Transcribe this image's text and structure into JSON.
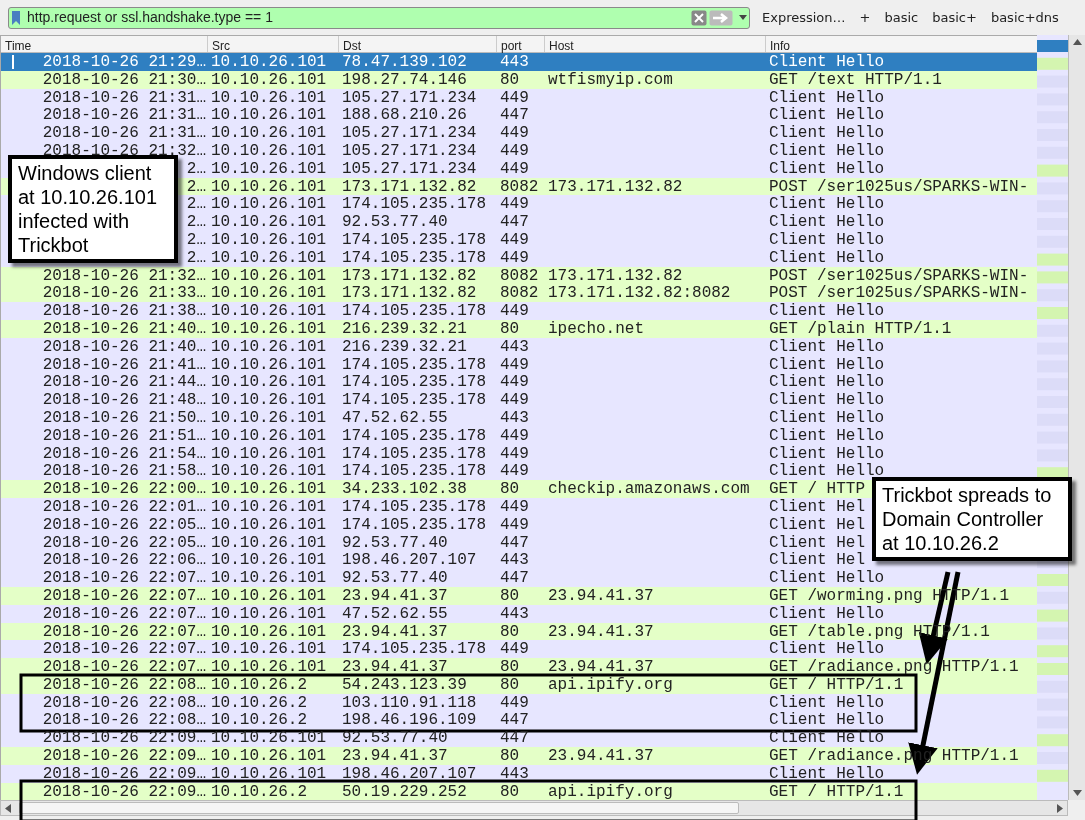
{
  "filter": {
    "value": "http.request or ssl.handshake.type == 1"
  },
  "toolbar_buttons": [
    "Expression…",
    "+",
    "basic",
    "basic+",
    "basic+dns"
  ],
  "table": {
    "columns": [
      "Time",
      "Src",
      "Dst",
      "port",
      "Host",
      "Info"
    ],
    "rows": [
      {
        "kind": "tls",
        "selected": true,
        "cells": [
          "2018-10-26 21:29…",
          "10.10.26.101",
          "78.47.139.102",
          "443",
          "",
          "Client Hello"
        ]
      },
      {
        "kind": "http",
        "selected": false,
        "cells": [
          "2018-10-26 21:30…",
          "10.10.26.101",
          "198.27.74.146",
          "80",
          "wtfismyip.com",
          "GET /text HTTP/1.1"
        ]
      },
      {
        "kind": "tls",
        "selected": false,
        "cells": [
          "2018-10-26 21:31…",
          "10.10.26.101",
          "105.27.171.234",
          "449",
          "",
          "Client Hello"
        ]
      },
      {
        "kind": "tls",
        "selected": false,
        "cells": [
          "2018-10-26 21:31…",
          "10.10.26.101",
          "188.68.210.26",
          "447",
          "",
          "Client Hello"
        ]
      },
      {
        "kind": "tls",
        "selected": false,
        "cells": [
          "2018-10-26 21:31…",
          "10.10.26.101",
          "105.27.171.234",
          "449",
          "",
          "Client Hello"
        ]
      },
      {
        "kind": "tls",
        "selected": false,
        "cells": [
          "2018-10-26 21:32…",
          "10.10.26.101",
          "105.27.171.234",
          "449",
          "",
          "Client Hello"
        ]
      },
      {
        "kind": "tls",
        "selected": false,
        "cells": [
          "2…",
          "10.10.26.101",
          "105.27.171.234",
          "449",
          "",
          "Client Hello"
        ]
      },
      {
        "kind": "http",
        "selected": false,
        "cells": [
          "2…",
          "10.10.26.101",
          "173.171.132.82",
          "8082",
          "173.171.132.82",
          "POST /ser1025us/SPARKS-WIN-"
        ]
      },
      {
        "kind": "tls",
        "selected": false,
        "cells": [
          "2…",
          "10.10.26.101",
          "174.105.235.178",
          "449",
          "",
          "Client Hello"
        ]
      },
      {
        "kind": "tls",
        "selected": false,
        "cells": [
          "2…",
          "10.10.26.101",
          "92.53.77.40",
          "447",
          "",
          "Client Hello"
        ]
      },
      {
        "kind": "tls",
        "selected": false,
        "cells": [
          "2…",
          "10.10.26.101",
          "174.105.235.178",
          "449",
          "",
          "Client Hello"
        ]
      },
      {
        "kind": "tls",
        "selected": false,
        "cells": [
          "2…",
          "10.10.26.101",
          "174.105.235.178",
          "449",
          "",
          "Client Hello"
        ]
      },
      {
        "kind": "http",
        "selected": false,
        "cells": [
          "2018-10-26 21:32…",
          "10.10.26.101",
          "173.171.132.82",
          "8082",
          "173.171.132.82",
          "POST /ser1025us/SPARKS-WIN-"
        ]
      },
      {
        "kind": "http",
        "selected": false,
        "cells": [
          "2018-10-26 21:33…",
          "10.10.26.101",
          "173.171.132.82",
          "8082",
          "173.171.132.82:8082",
          "POST /ser1025us/SPARKS-WIN-"
        ]
      },
      {
        "kind": "tls",
        "selected": false,
        "cells": [
          "2018-10-26 21:38…",
          "10.10.26.101",
          "174.105.235.178",
          "449",
          "",
          "Client Hello"
        ]
      },
      {
        "kind": "http",
        "selected": false,
        "cells": [
          "2018-10-26 21:40…",
          "10.10.26.101",
          "216.239.32.21",
          "80",
          "ipecho.net",
          "GET /plain HTTP/1.1"
        ]
      },
      {
        "kind": "tls",
        "selected": false,
        "cells": [
          "2018-10-26 21:40…",
          "10.10.26.101",
          "216.239.32.21",
          "443",
          "",
          "Client Hello"
        ]
      },
      {
        "kind": "tls",
        "selected": false,
        "cells": [
          "2018-10-26 21:41…",
          "10.10.26.101",
          "174.105.235.178",
          "449",
          "",
          "Client Hello"
        ]
      },
      {
        "kind": "tls",
        "selected": false,
        "cells": [
          "2018-10-26 21:44…",
          "10.10.26.101",
          "174.105.235.178",
          "449",
          "",
          "Client Hello"
        ]
      },
      {
        "kind": "tls",
        "selected": false,
        "cells": [
          "2018-10-26 21:48…",
          "10.10.26.101",
          "174.105.235.178",
          "449",
          "",
          "Client Hello"
        ]
      },
      {
        "kind": "tls",
        "selected": false,
        "cells": [
          "2018-10-26 21:50…",
          "10.10.26.101",
          "47.52.62.55",
          "443",
          "",
          "Client Hello"
        ]
      },
      {
        "kind": "tls",
        "selected": false,
        "cells": [
          "2018-10-26 21:51…",
          "10.10.26.101",
          "174.105.235.178",
          "449",
          "",
          "Client Hello"
        ]
      },
      {
        "kind": "tls",
        "selected": false,
        "cells": [
          "2018-10-26 21:54…",
          "10.10.26.101",
          "174.105.235.178",
          "449",
          "",
          "Client Hello"
        ]
      },
      {
        "kind": "tls",
        "selected": false,
        "cells": [
          "2018-10-26 21:58…",
          "10.10.26.101",
          "174.105.235.178",
          "449",
          "",
          "Client Hello"
        ]
      },
      {
        "kind": "http",
        "selected": false,
        "cells": [
          "2018-10-26 22:00…",
          "10.10.26.101",
          "34.233.102.38",
          "80",
          "checkip.amazonaws.com",
          "GET / HTTP"
        ]
      },
      {
        "kind": "tls",
        "selected": false,
        "cells": [
          "2018-10-26 22:01…",
          "10.10.26.101",
          "174.105.235.178",
          "449",
          "",
          "Client Hel"
        ]
      },
      {
        "kind": "tls",
        "selected": false,
        "cells": [
          "2018-10-26 22:05…",
          "10.10.26.101",
          "174.105.235.178",
          "449",
          "",
          "Client Hel"
        ]
      },
      {
        "kind": "tls",
        "selected": false,
        "cells": [
          "2018-10-26 22:05…",
          "10.10.26.101",
          "92.53.77.40",
          "447",
          "",
          "Client Hel"
        ]
      },
      {
        "kind": "tls",
        "selected": false,
        "cells": [
          "2018-10-26 22:06…",
          "10.10.26.101",
          "198.46.207.107",
          "443",
          "",
          "Client Hel"
        ]
      },
      {
        "kind": "tls",
        "selected": false,
        "cells": [
          "2018-10-26 22:07…",
          "10.10.26.101",
          "92.53.77.40",
          "447",
          "",
          "Client Hello"
        ]
      },
      {
        "kind": "http",
        "selected": false,
        "cells": [
          "2018-10-26 22:07…",
          "10.10.26.101",
          "23.94.41.37",
          "80",
          "23.94.41.37",
          "GET /worming.png HTTP/1.1"
        ]
      },
      {
        "kind": "tls",
        "selected": false,
        "cells": [
          "2018-10-26 22:07…",
          "10.10.26.101",
          "47.52.62.55",
          "443",
          "",
          "Client Hello"
        ]
      },
      {
        "kind": "http",
        "selected": false,
        "cells": [
          "2018-10-26 22:07…",
          "10.10.26.101",
          "23.94.41.37",
          "80",
          "23.94.41.37",
          "GET /table.png HTTP/1.1"
        ]
      },
      {
        "kind": "tls",
        "selected": false,
        "cells": [
          "2018-10-26 22:07…",
          "10.10.26.101",
          "174.105.235.178",
          "449",
          "",
          "Client Hello"
        ]
      },
      {
        "kind": "http",
        "selected": false,
        "cells": [
          "2018-10-26 22:07…",
          "10.10.26.101",
          "23.94.41.37",
          "80",
          "23.94.41.37",
          "GET /radiance.png HTTP/1.1"
        ]
      },
      {
        "kind": "http",
        "selected": false,
        "cells": [
          "2018-10-26 22:08…",
          "10.10.26.2",
          "54.243.123.39",
          "80",
          "api.ipify.org",
          "GET / HTTP/1.1"
        ]
      },
      {
        "kind": "tls",
        "selected": false,
        "cells": [
          "2018-10-26 22:08…",
          "10.10.26.2",
          "103.110.91.118",
          "449",
          "",
          "Client Hello"
        ]
      },
      {
        "kind": "tls",
        "selected": false,
        "cells": [
          "2018-10-26 22:08…",
          "10.10.26.2",
          "198.46.196.109",
          "447",
          "",
          "Client Hello"
        ]
      },
      {
        "kind": "tls",
        "selected": false,
        "cells": [
          "2018-10-26 22:09…",
          "10.10.26.101",
          "92.53.77.40",
          "447",
          "",
          "Client Hello"
        ]
      },
      {
        "kind": "http",
        "selected": false,
        "cells": [
          "2018-10-26 22:09…",
          "10.10.26.101",
          "23.94.41.37",
          "80",
          "23.94.41.37",
          "GET /radiance.png HTTP/1.1"
        ]
      },
      {
        "kind": "tls",
        "selected": false,
        "cells": [
          "2018-10-26 22:09…",
          "10.10.26.101",
          "198.46.207.107",
          "443",
          "",
          "Client Hello"
        ]
      },
      {
        "kind": "http",
        "selected": false,
        "cells": [
          "2018-10-26 22:09…",
          "10.10.26.2",
          "50.19.229.252",
          "80",
          "api.ipify.org",
          "GET / HTTP/1.1"
        ]
      }
    ]
  },
  "annotations": [
    {
      "lines": [
        "Windows client",
        "at 10.10.26.101",
        "infected with",
        "Trickbot"
      ]
    },
    {
      "lines": [
        "Trickbot spreads to",
        "Domain Controller",
        "at 10.10.26.2"
      ]
    }
  ]
}
